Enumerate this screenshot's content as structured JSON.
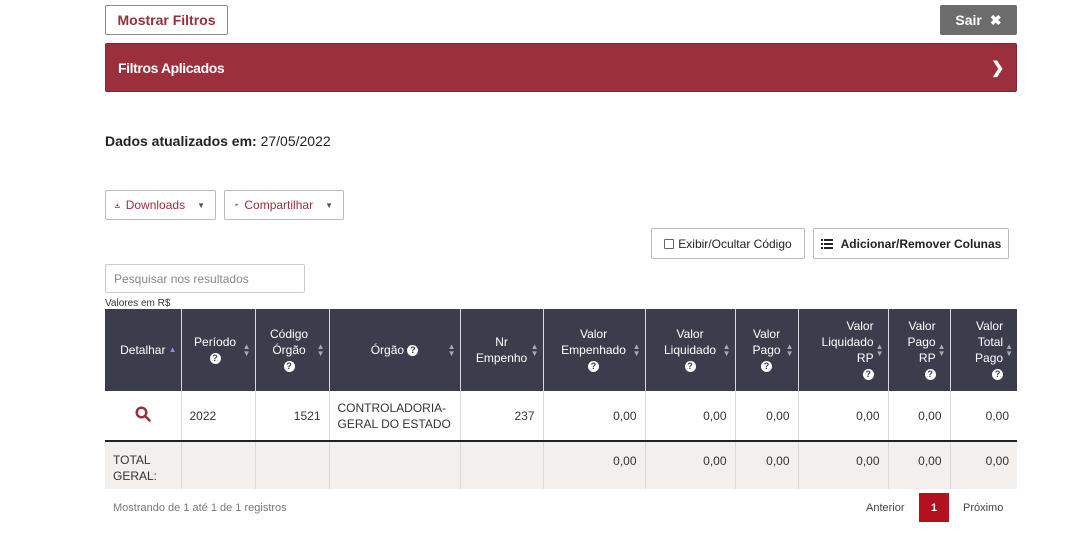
{
  "toolbar": {
    "show_filters_label": "Mostrar Filtros",
    "exit_label": "Sair",
    "exit_icon": "close-icon"
  },
  "filters_bar": {
    "title": "Filtros Aplicados",
    "icon": "chevron-right-icon"
  },
  "updated": {
    "label": "Dados atualizados em:",
    "date": "27/05/2022"
  },
  "actions": {
    "downloads_label": "Downloads",
    "share_label": "Compartilhar",
    "toggle_code_label": "Exibir/Ocultar Código",
    "columns_label": "Adicionar/Remover Colunas"
  },
  "search": {
    "placeholder": "Pesquisar nos resultados",
    "value": ""
  },
  "currency_note": "Valores em R$",
  "table": {
    "headers": [
      "Detalhar",
      "Período",
      "Código Órgão",
      "Órgão",
      "Nr Empenho",
      "Valor Empenhado",
      "Valor Liquidado",
      "Valor Pago",
      "Valor Liquidado RP",
      "Valor Pago RP",
      "Valor Total Pago"
    ],
    "rows": [
      {
        "periodo": "2022",
        "codigo_orgao": "1521",
        "orgao": "CONTROLADORIA-GERAL DO ESTADO",
        "nr_empenho": "237",
        "valor_empenhado": "0,00",
        "valor_liquidado": "0,00",
        "valor_pago": "0,00",
        "valor_liquidado_rp": "0,00",
        "valor_pago_rp": "0,00",
        "valor_total_pago": "0,00"
      }
    ],
    "total": {
      "label": "TOTAL GERAL:",
      "valor_empenhado": "0,00",
      "valor_liquidado": "0,00",
      "valor_pago": "0,00",
      "valor_liquidado_rp": "0,00",
      "valor_pago_rp": "0,00",
      "valor_total_pago": "0,00"
    }
  },
  "pagination": {
    "info": "Mostrando de 1 até 1 de 1 registros",
    "prev_label": "Anterior",
    "current_page": "1",
    "next_label": "Próximo"
  },
  "colors": {
    "brand": "#9b2f3c",
    "header_bg": "#3c3d4c",
    "page_active": "#b4111f",
    "exit_bg": "#6c6c6c"
  }
}
